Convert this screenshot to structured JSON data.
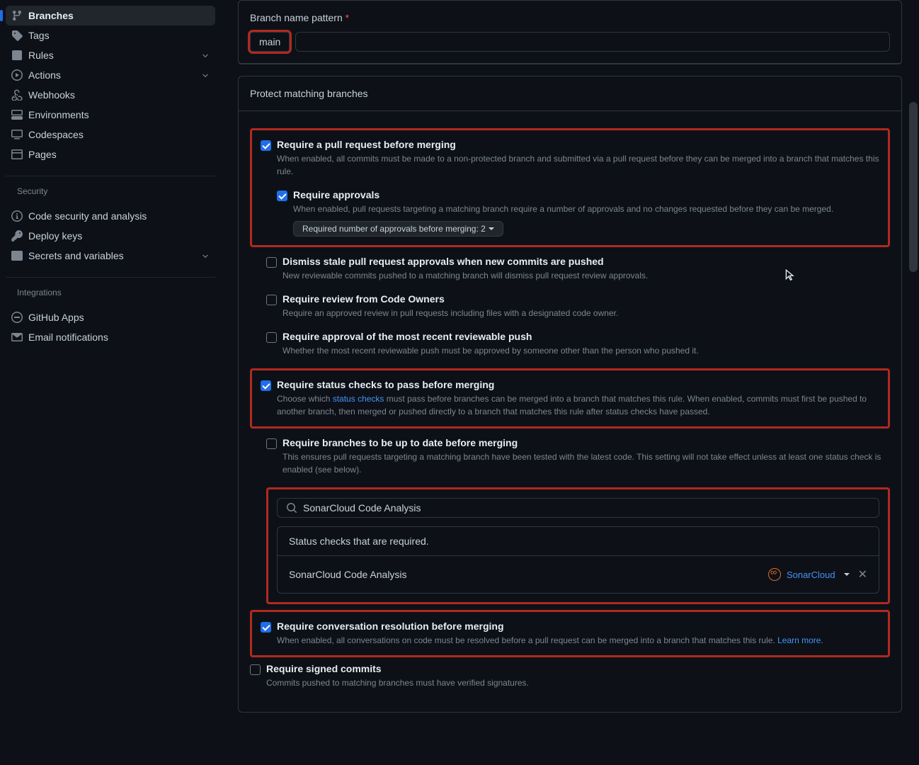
{
  "sidebar": {
    "items": [
      {
        "label": "Branches"
      },
      {
        "label": "Tags"
      },
      {
        "label": "Rules"
      },
      {
        "label": "Actions"
      },
      {
        "label": "Webhooks"
      },
      {
        "label": "Environments"
      },
      {
        "label": "Codespaces"
      },
      {
        "label": "Pages"
      }
    ],
    "securityHeading": "Security",
    "security": [
      {
        "label": "Code security and analysis"
      },
      {
        "label": "Deploy keys"
      },
      {
        "label": "Secrets and variables"
      }
    ],
    "integrationsHeading": "Integrations",
    "integrations": [
      {
        "label": "GitHub Apps"
      },
      {
        "label": "Email notifications"
      }
    ]
  },
  "branchPattern": {
    "label": "Branch name pattern",
    "value": "main"
  },
  "protectHeading": "Protect matching branches",
  "rules": {
    "requirePR": {
      "title": "Require a pull request before merging",
      "desc": "When enabled, all commits must be made to a non-protected branch and submitted via a pull request before they can be merged into a branch that matches this rule."
    },
    "requireApprovals": {
      "title": "Require approvals",
      "desc": "When enabled, pull requests targeting a matching branch require a number of approvals and no changes requested before they can be merged.",
      "select": "Required number of approvals before merging: 2"
    },
    "dismissStale": {
      "title": "Dismiss stale pull request approvals when new commits are pushed",
      "desc": "New reviewable commits pushed to a matching branch will dismiss pull request review approvals."
    },
    "codeOwners": {
      "title": "Require review from Code Owners",
      "desc": "Require an approved review in pull requests including files with a designated code owner."
    },
    "recentPush": {
      "title": "Require approval of the most recent reviewable push",
      "desc": "Whether the most recent reviewable push must be approved by someone other than the person who pushed it."
    },
    "statusChecks": {
      "title": "Require status checks to pass before merging",
      "descPre": "Choose which ",
      "descLink": "status checks",
      "descPost": " must pass before branches can be merged into a branch that matches this rule. When enabled, commits must first be pushed to another branch, then merged or pushed directly to a branch that matches this rule after status checks have passed."
    },
    "upToDate": {
      "title": "Require branches to be up to date before merging",
      "desc": "This ensures pull requests targeting a matching branch have been tested with the latest code. This setting will not take effect unless at least one status check is enabled (see below)."
    },
    "search": {
      "value": "SonarCloud Code Analysis"
    },
    "statusTable": {
      "header": "Status checks that are required.",
      "item": "SonarCloud Code Analysis",
      "app": "SonarCloud"
    },
    "conversation": {
      "title": "Require conversation resolution before merging",
      "desc": "When enabled, all conversations on code must be resolved before a pull request can be merged into a branch that matches this rule. ",
      "learnMore": "Learn more"
    },
    "signedCommits": {
      "title": "Require signed commits",
      "desc": "Commits pushed to matching branches must have verified signatures."
    }
  }
}
